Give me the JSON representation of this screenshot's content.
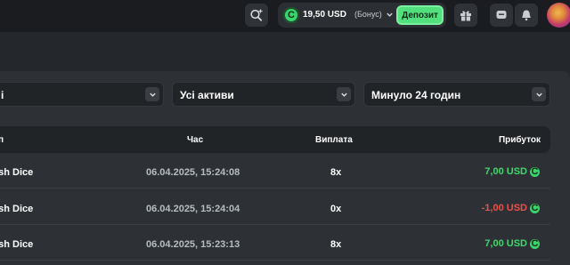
{
  "header": {
    "balance_amount": "19,50 USD",
    "balance_bonus": "(Бонус)",
    "deposit_label": "Депозит",
    "coin_symbol": "C",
    "accent_color": "#52e07e"
  },
  "filters": [
    {
      "label": "і"
    },
    {
      "label": "Усі активи"
    },
    {
      "label": "Минуло 24 годин"
    }
  ],
  "table": {
    "columns": [
      "п",
      "Час",
      "Виплата",
      "Прибуток"
    ],
    "rows": [
      {
        "game": "ash Dice",
        "time": "06.04.2025, 15:24:08",
        "payout": "8x",
        "profit": "7,00 USD",
        "profit_color": "#43d66f"
      },
      {
        "game": "ash Dice",
        "time": "06.04.2025, 15:24:04",
        "payout": "0x",
        "profit": "-1,00 USD",
        "profit_color": "#e8514c"
      },
      {
        "game": "ash Dice",
        "time": "06.04.2025, 15:23:13",
        "payout": "8x",
        "profit": "7,00 USD",
        "profit_color": "#43d66f"
      }
    ]
  }
}
